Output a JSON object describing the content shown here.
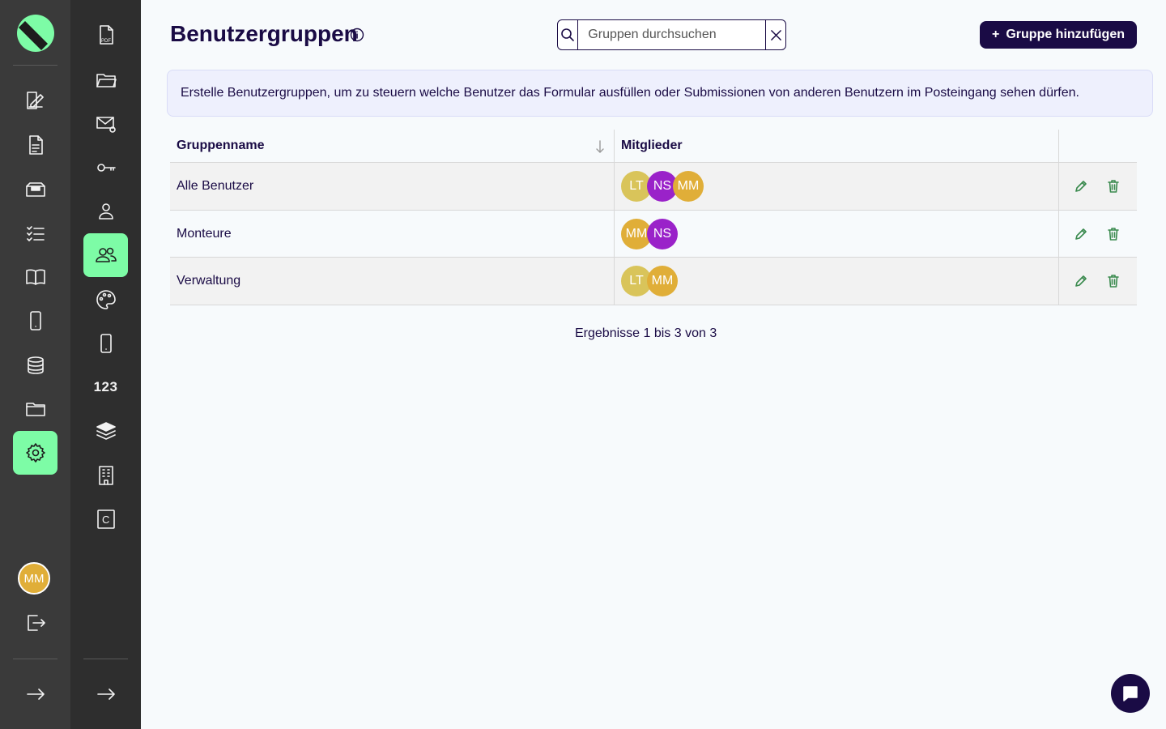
{
  "rail1": {
    "items": [
      {
        "icon": "form-edit-icon"
      },
      {
        "icon": "document-icon"
      },
      {
        "icon": "inbox-icon"
      },
      {
        "icon": "checklist-icon"
      },
      {
        "icon": "book-icon"
      },
      {
        "icon": "phone-icon"
      },
      {
        "icon": "database-icon"
      },
      {
        "icon": "folder-icon"
      },
      {
        "icon": "gear-icon",
        "active": true
      }
    ],
    "user_initials": "MM"
  },
  "rail2": {
    "items": [
      {
        "icon": "pdf-icon",
        "badge": "PDF"
      },
      {
        "icon": "folder-open-icon"
      },
      {
        "icon": "mail-at-icon"
      },
      {
        "icon": "key-icon"
      },
      {
        "icon": "user-icon"
      },
      {
        "icon": "users-icon",
        "active": true
      },
      {
        "icon": "palette-icon"
      },
      {
        "icon": "phone-icon"
      },
      {
        "icon": "numbers-icon",
        "text": "123"
      },
      {
        "icon": "layers-icon"
      },
      {
        "icon": "building-icon"
      },
      {
        "icon": "c-box-icon",
        "text": "C"
      }
    ]
  },
  "header": {
    "title": "Benutzergruppen",
    "search_placeholder": "Gruppen durchsuchen",
    "add_label": "Gruppe hinzufügen",
    "add_prefix": "+"
  },
  "notice": "Erstelle Benutzergruppen, um zu steuern welche Benutzer das Formular ausfüllen oder Submissionen von anderen Benutzern im Posteingang sehen dürfen.",
  "table": {
    "columns": [
      "Gruppenname",
      "Mitglieder",
      ""
    ],
    "rows": [
      {
        "name": "Alle Benutzer",
        "members": [
          {
            "initials": "LT",
            "color": "#d9c45a"
          },
          {
            "initials": "NS",
            "color": "#9a22c9"
          },
          {
            "initials": "MM",
            "color": "#e0ae38"
          }
        ]
      },
      {
        "name": "Monteure",
        "members": [
          {
            "initials": "MM",
            "color": "#e0ae38"
          },
          {
            "initials": "NS",
            "color": "#9a22c9"
          }
        ]
      },
      {
        "name": "Verwaltung",
        "members": [
          {
            "initials": "LT",
            "color": "#d9c45a"
          },
          {
            "initials": "MM",
            "color": "#e0ae38"
          }
        ]
      }
    ]
  },
  "results_text": "Ergebnisse 1 bis 3 von 3",
  "colors": {
    "accent": "#7dfca6",
    "primary": "#1a0b45",
    "action": "#3a8a4e"
  }
}
